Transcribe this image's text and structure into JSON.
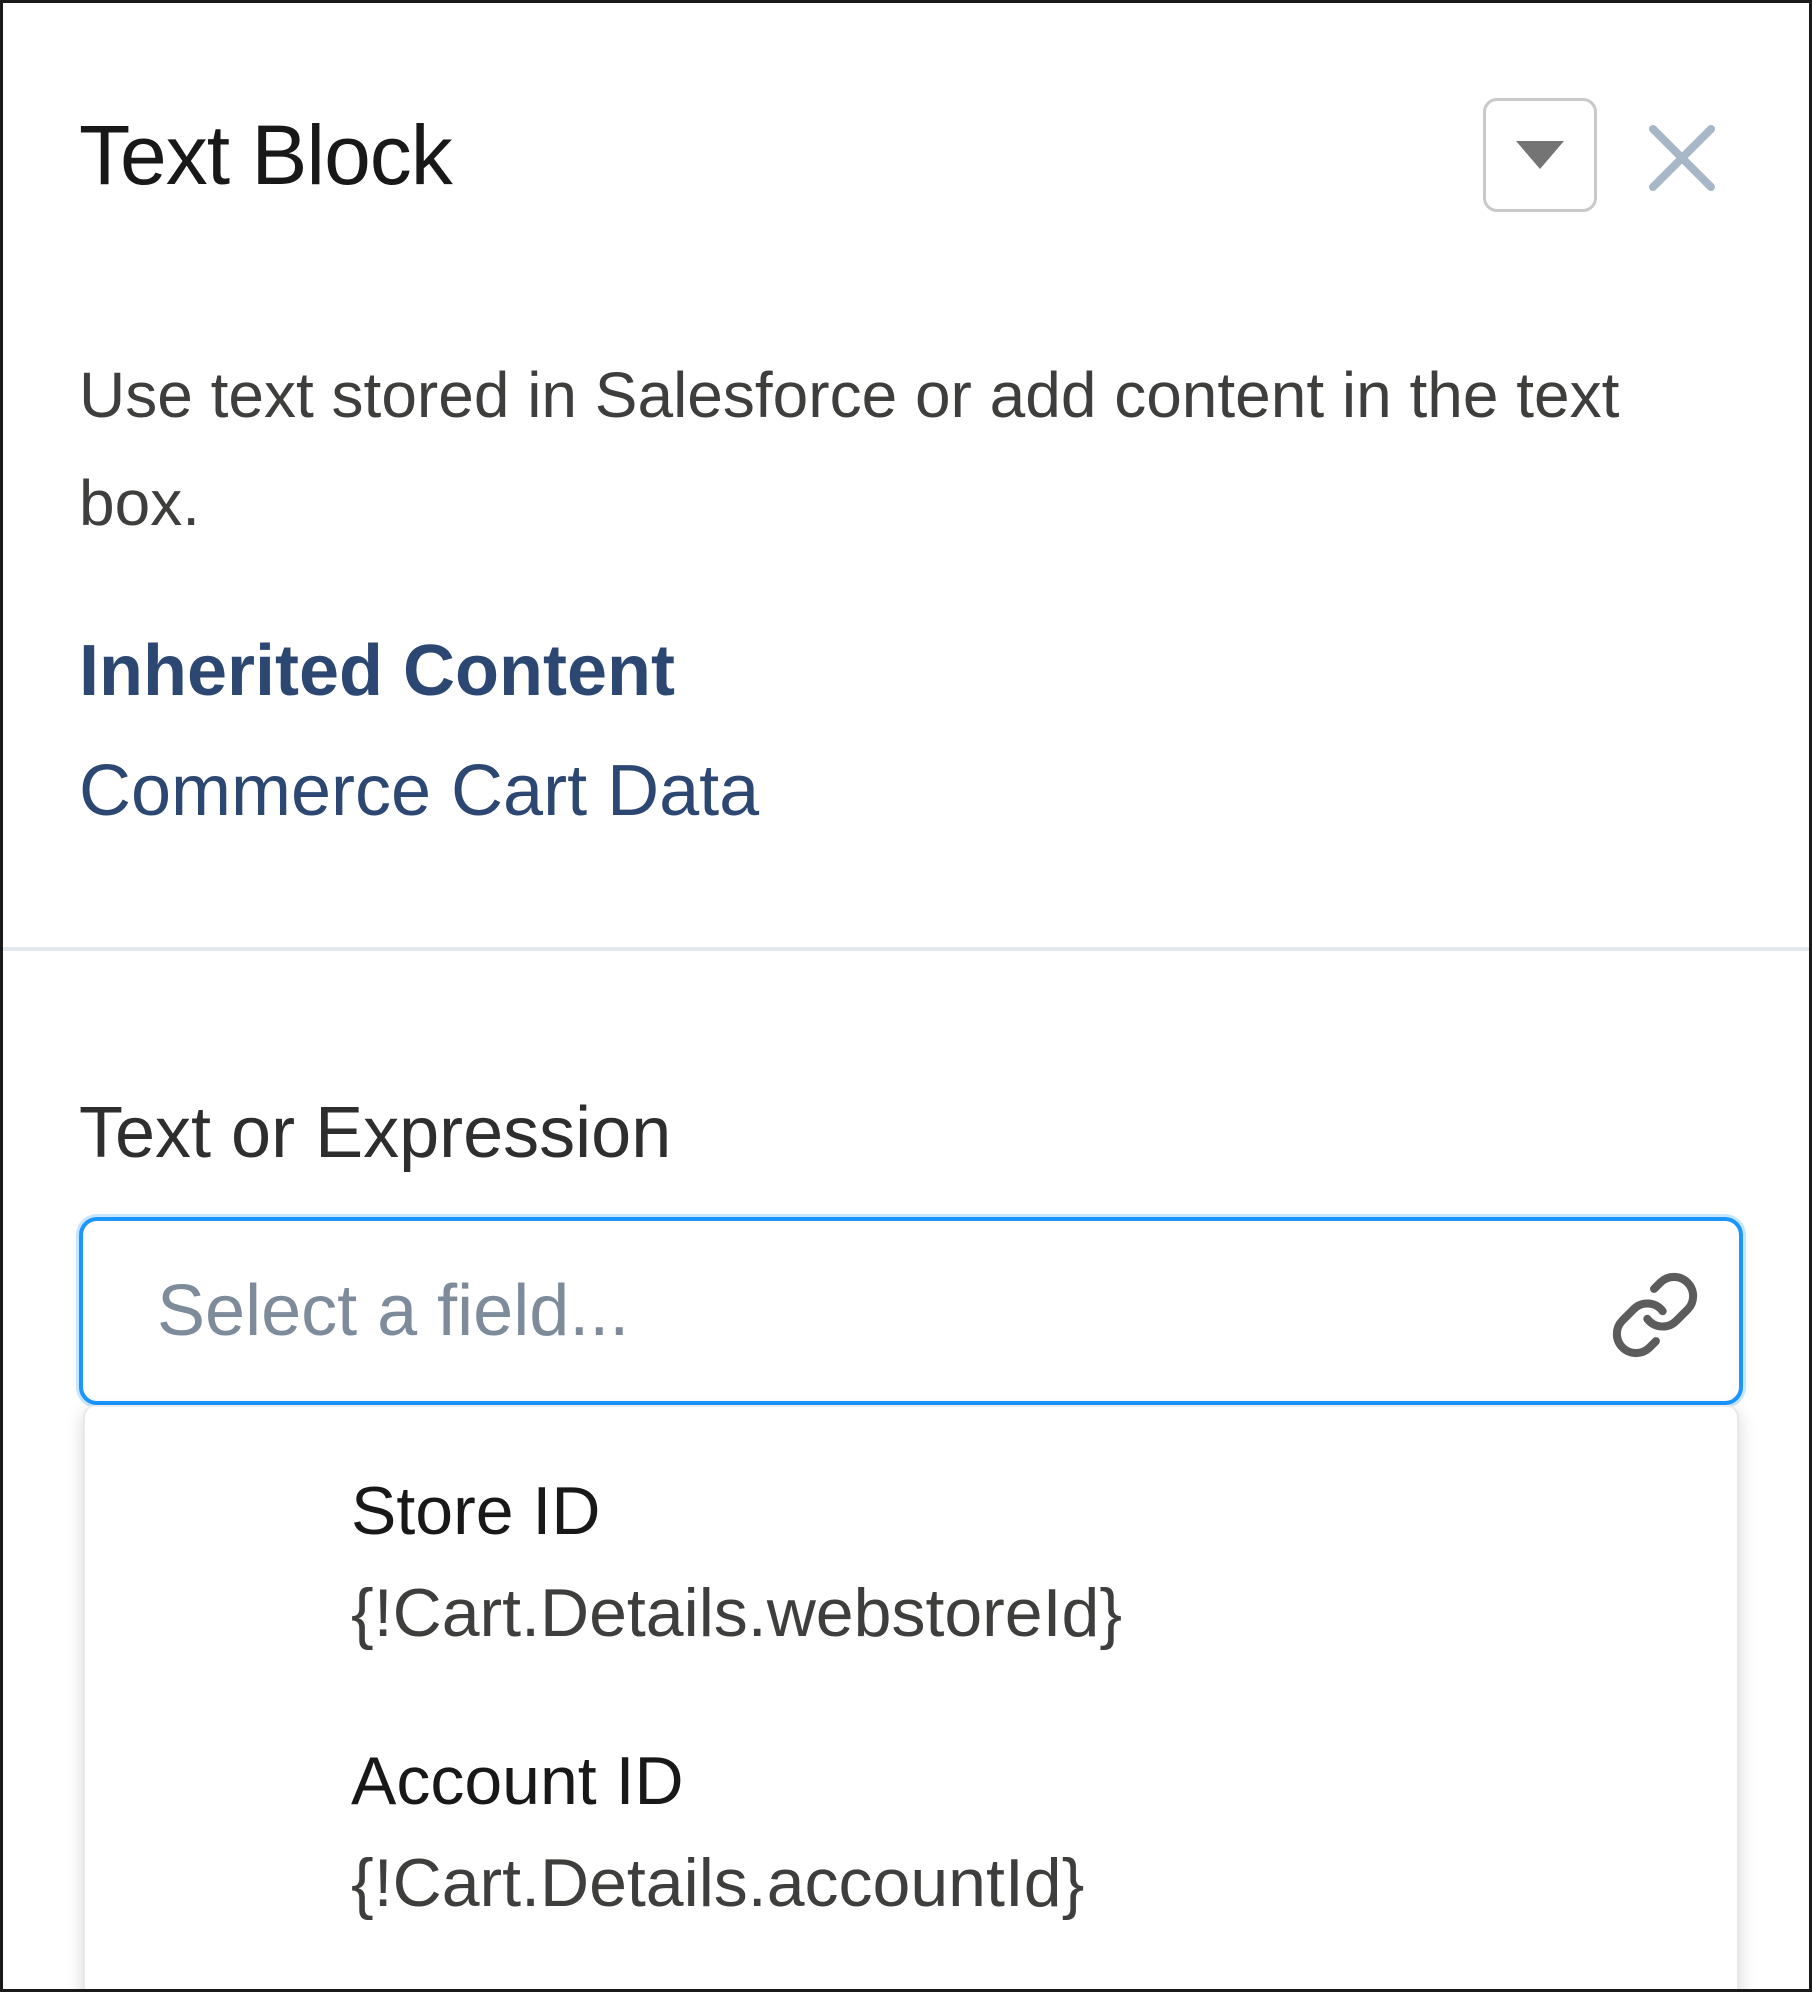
{
  "panel": {
    "title": "Text Block",
    "menu_icon": "chevron-down-icon",
    "close_icon": "close-icon",
    "description": "Use text stored in Salesforce or add content in the text box."
  },
  "inherited": {
    "heading": "Inherited Content",
    "value": "Commerce Cart Data"
  },
  "field": {
    "label": "Text or Expression",
    "value": "",
    "placeholder": "Select a field...",
    "link_icon": "link-icon"
  },
  "dropdown": {
    "options": [
      {
        "label": "Store ID",
        "expression": "{!Cart.Details.webstoreId}"
      },
      {
        "label": "Account ID",
        "expression": "{!Cart.Details.accountId}"
      }
    ]
  },
  "colors": {
    "heading": "#2d4773",
    "focus_border": "#1b96ff",
    "placeholder": "#7d8b9b",
    "close_icon": "#a8b7c7"
  }
}
